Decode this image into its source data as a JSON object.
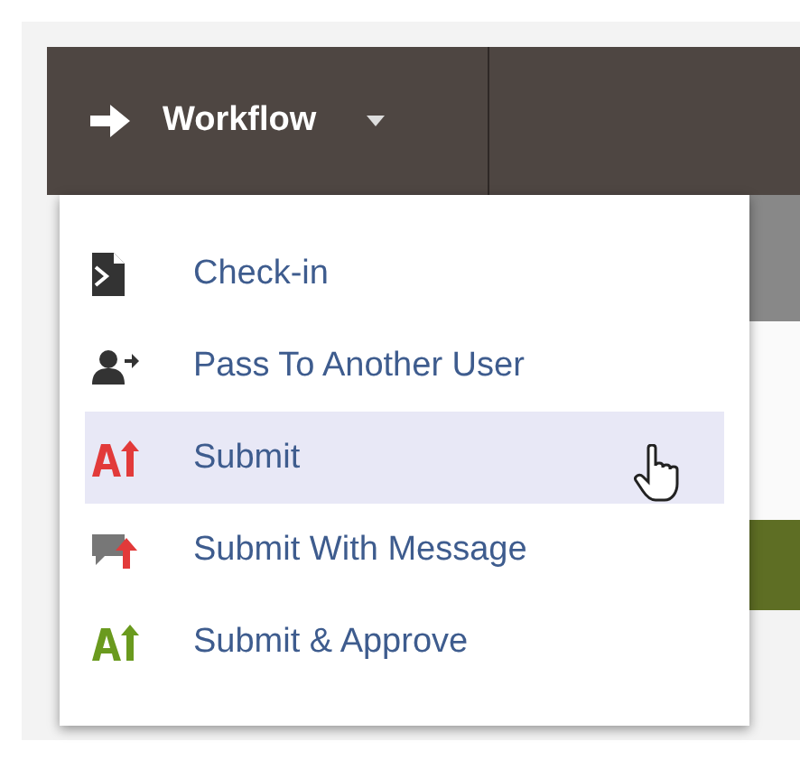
{
  "toolbar": {
    "menu_button": {
      "label": "Workflow",
      "expanded": true
    }
  },
  "menu": {
    "items": [
      {
        "label": "Check-in",
        "kind": "checkin",
        "selected": false
      },
      {
        "label": "Pass To Another User",
        "kind": "pass",
        "selected": false
      },
      {
        "label": "Submit",
        "kind": "submit",
        "selected": true
      },
      {
        "label": "Submit With Message",
        "kind": "message",
        "selected": false
      },
      {
        "label": "Submit & Approve",
        "kind": "approve",
        "selected": false
      }
    ]
  }
}
